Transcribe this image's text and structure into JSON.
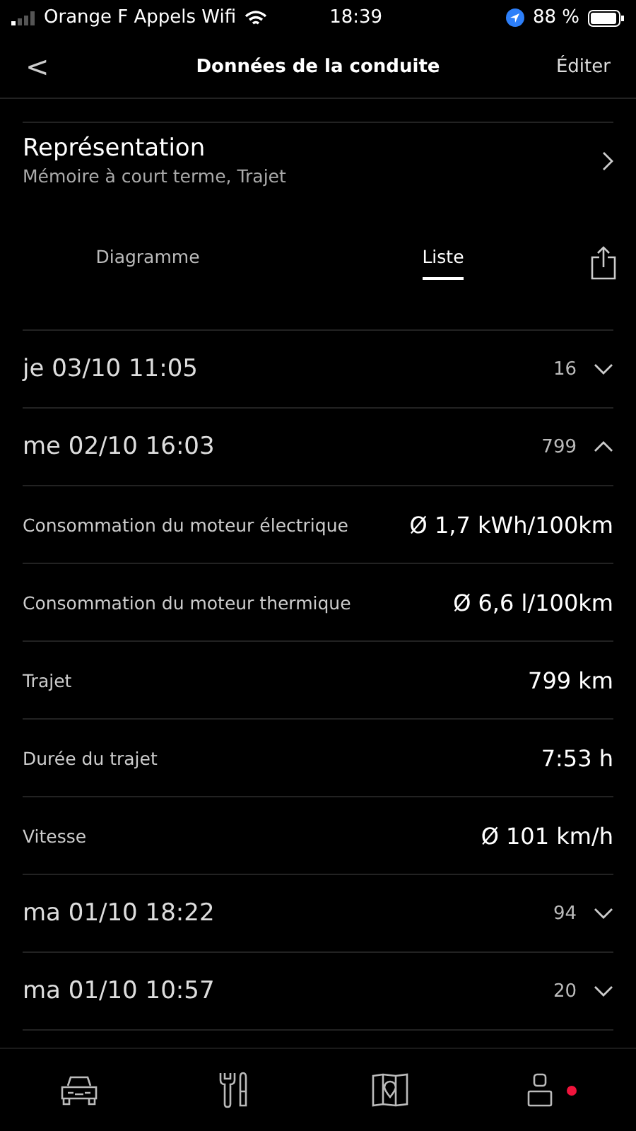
{
  "status_bar": {
    "carrier": "Orange F Appels Wifi",
    "time": "18:39",
    "battery": "88 %"
  },
  "nav": {
    "back": "<",
    "title": "Données de la conduite",
    "action": "Éditer"
  },
  "representation": {
    "title": "Représentation",
    "subtitle": "Mémoire à court terme, Trajet"
  },
  "tabs": [
    {
      "label": "Diagramme",
      "selected": false
    },
    {
      "label": "Liste",
      "selected": true
    }
  ],
  "trips": [
    {
      "date": "je 03/10 11:05",
      "count": "16",
      "expanded": false
    },
    {
      "date": "me 02/10 16:03",
      "count": "799",
      "expanded": true,
      "details": [
        {
          "label": "Consommation du moteur électrique",
          "value": "Ø 1,7 kWh/100km"
        },
        {
          "label": "Consommation du moteur thermique",
          "value": "Ø 6,6 l/100km"
        },
        {
          "label": "Trajet",
          "value": "799 km"
        },
        {
          "label": "Durée du trajet",
          "value": "7:53 h"
        },
        {
          "label": "Vitesse",
          "value": "Ø 101 km/h"
        }
      ]
    },
    {
      "date": "ma 01/10 18:22",
      "count": "94",
      "expanded": false
    },
    {
      "date": "ma 01/10 10:57",
      "count": "20",
      "expanded": false
    }
  ]
}
